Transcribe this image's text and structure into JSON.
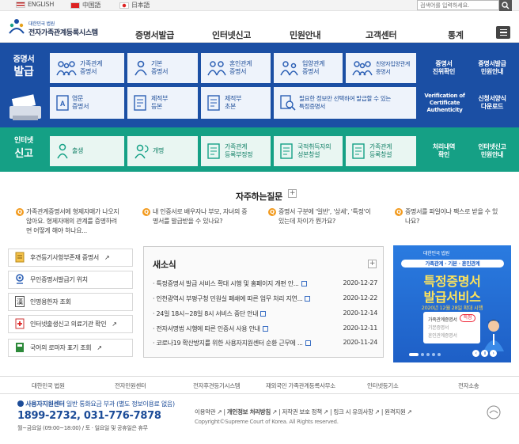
{
  "top": {
    "langs": [
      "ENGLISH",
      "中国語",
      "日本語"
    ],
    "search_placeholder": "검색어를 입력하세요."
  },
  "logo": {
    "small": "대한민국 법원",
    "big": "전자가족관계등록시스템"
  },
  "nav": [
    "증명서발급",
    "인터넷신고",
    "민원안내",
    "고객센터",
    "통계"
  ],
  "cert": {
    "label1": "증명서",
    "label2": "발급",
    "cards": [
      {
        "line1": "가족관계",
        "line2": "증명서",
        "icon": "family-icon"
      },
      {
        "line1": "기본",
        "line2": "증명서",
        "icon": "person-icon"
      },
      {
        "line1": "혼인관계",
        "line2": "증명서",
        "icon": "couple-icon"
      },
      {
        "line1": "입양관계",
        "line2": "증명서",
        "icon": "adoption-icon"
      },
      {
        "line1": "친양자입양관계",
        "line2": "증명서",
        "icon": "family-icon"
      },
      {
        "line1": "영문",
        "line2": "증명서",
        "icon": "document-a-icon"
      },
      {
        "line1": "제적부",
        "line2": "등본",
        "icon": "register-icon"
      },
      {
        "line1": "제적부",
        "line2": "초본",
        "icon": "register-icon"
      },
      {
        "line1": "필요한 정보만 선택하여 발급할 수 있는",
        "line2": "특정증명서",
        "icon": "magnifier-doc-icon"
      }
    ],
    "side": [
      {
        "line1": "증명서",
        "line2": "진위확인",
        "line3": ""
      },
      {
        "line1": "증명서발급",
        "line2": "민원안내",
        "line3": ""
      },
      {
        "line1": "Verification of",
        "line2": "Certificate",
        "line3": "Authenticity"
      },
      {
        "line1": "신청서양식",
        "line2": "다운로드",
        "line3": ""
      }
    ]
  },
  "report": {
    "label1": "인터넷",
    "label2": "신고",
    "cards": [
      {
        "line1": "출생",
        "line2": "",
        "icon": "baby-icon"
      },
      {
        "line1": "개명",
        "line2": "",
        "icon": "rename-icon"
      },
      {
        "line1": "가족관계",
        "line2": "등록부정정",
        "icon": "form-icon"
      },
      {
        "line1": "국적취득자의",
        "line2": "성본창설",
        "icon": "form-icon"
      },
      {
        "line1": "가족관계",
        "line2": "등록창설",
        "icon": "form-icon"
      }
    ],
    "side": [
      {
        "line1": "처리내역",
        "line2": "확인"
      },
      {
        "line1": "인터넷신고",
        "line2": "민원안내"
      }
    ]
  },
  "faq": {
    "title": "자주하는질문",
    "items": [
      {
        "line1": "가족관계증명서에 형제자매가 나오지",
        "line2": "않아요. 형제자매의 관계를 증명하려",
        "line3": "면 어떻게 해야 하나요..."
      },
      {
        "line1": "내 인증서로 배우자나 부모, 자녀의 증",
        "line2": "명서를 발급받을 수 있나요?",
        "line3": ""
      },
      {
        "line1": "증명서 구분에 '일반', '상세', '특정'이",
        "line2": "있는데 차이가 뭔가요?",
        "line3": ""
      },
      {
        "line1": "증명서를 파일이나 팩스로 받을 수 있",
        "line2": "나요?",
        "line3": ""
      }
    ]
  },
  "quick": [
    {
      "label": "후견등기사항부존재 증명서",
      "icon": "document-icon",
      "ext": "↗"
    },
    {
      "label": "무인증명서발급기 위치",
      "icon": "location-icon",
      "ext": ""
    },
    {
      "label": "인명용한자 조회",
      "icon": "hanja-icon",
      "ext": ""
    },
    {
      "label": "인터넷출생신고 의료기관 확인",
      "icon": "hospital-icon",
      "ext": "↗"
    },
    {
      "label": "국어의 로마자 표기 조회",
      "icon": "book-icon",
      "ext": "↗"
    }
  ],
  "news": {
    "title": "새소식",
    "items": [
      {
        "title": "특정증명서 발급 서비스 확대 시행 및 홈페이지 개편 안...",
        "date": "2020-12-27"
      },
      {
        "title": "인천광역시 부평구청 민원실 폐쇄에 따른 업무 처리 지연...",
        "date": "2020-12-22"
      },
      {
        "title": "24일 18시~28일 8시 서비스 중단 안내",
        "date": "2020-12-14"
      },
      {
        "title": "전자서명법 시행에 따른 인증서 사용 안내",
        "date": "2020-12-11"
      },
      {
        "title": "코로나19 확산방지를 위한 사용자지원센터 순환 근무에 ...",
        "date": "2020-11-24"
      }
    ]
  },
  "banner": {
    "court": "대한민국 법원",
    "subtitle": "가족관계 · 기본 · 혼인관계",
    "title1": "특정증명서",
    "title2": "발급서비스",
    "date": "2020년 12월 28일 확대 시행",
    "card_line1": "가족관계증명서",
    "card_line2": "기본증명서",
    "card_line3": "혼인관계증명서",
    "badge": "특정"
  },
  "footer": {
    "links": [
      "대한민국 법원",
      "전자민원센터",
      "전자후견등기시스템",
      "재외국민 가족관계등록사무소",
      "인터넷등기소",
      "전자소송"
    ],
    "help_title": "사용자지원센터",
    "help_note": "일반 통화요금 부과 (별도 정보이용료 없음)",
    "phone": "1899-2732, 031-776-7878",
    "hours": "월~금요일 (09:00~18:00) / 토 · 일요일 및 공휴일은 휴무",
    "nav": [
      "이용약관",
      "개인정보 처리방침",
      "저작권 보호 정책",
      "링크 시 유의사항",
      "원격지원"
    ],
    "copyright": "Copyright©Supreme Court of Korea. All Rights reserved."
  }
}
